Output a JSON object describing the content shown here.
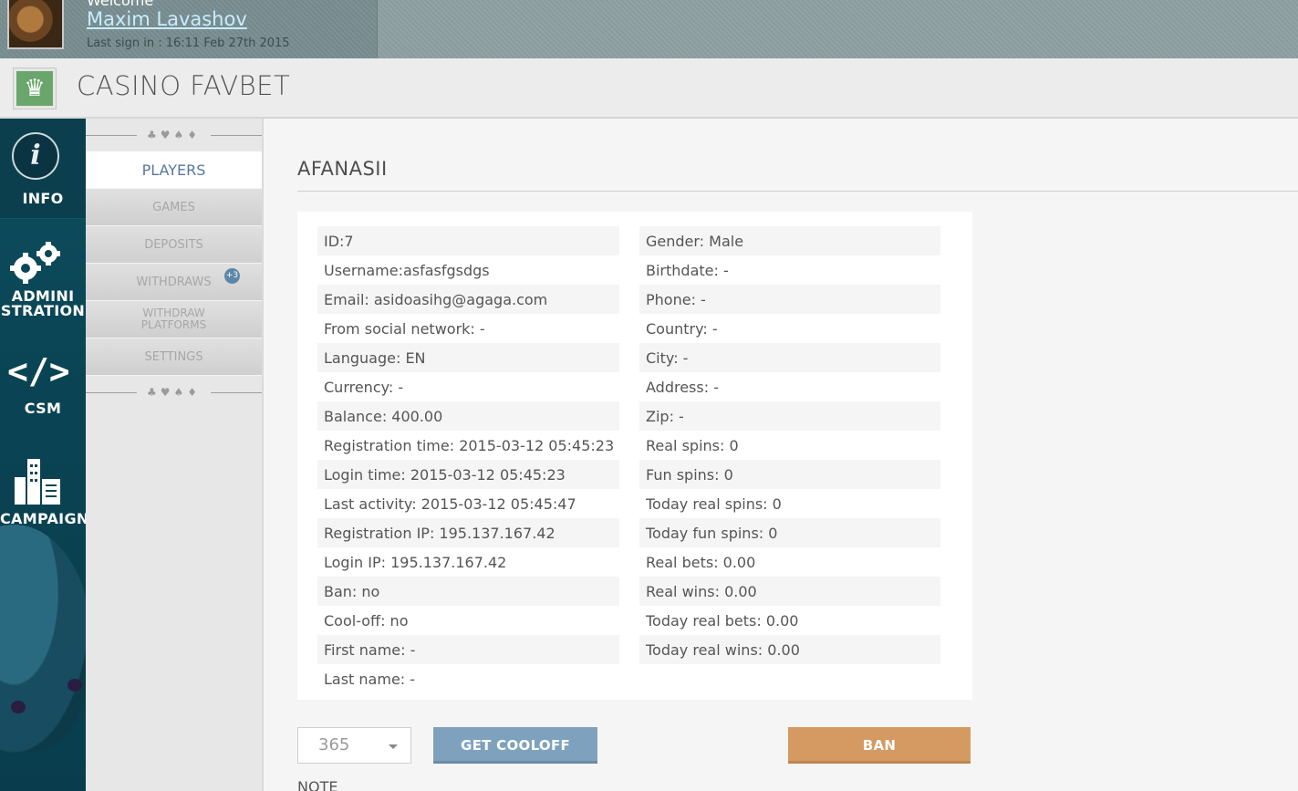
{
  "header": {
    "welcome": "Welcome",
    "user_name": "Maxim Lavashov",
    "last_sign_in": "Last sign in : 16:11 Feb 27th 2015"
  },
  "brand": {
    "title": "CASINO FAVBET",
    "logo_icon": "crown-icon",
    "logo_color": "#6aa66b"
  },
  "left_nav": {
    "items": [
      {
        "label": "INFO",
        "icon": "info-icon"
      },
      {
        "label_line1": "ADMINI",
        "label_line2": "STRATION",
        "icon": "gears-icon"
      },
      {
        "label": "CSM",
        "icon": "code-icon"
      },
      {
        "label": "CAMPAIGNS",
        "icon": "buildings-icon"
      }
    ]
  },
  "sub_nav": {
    "suits": "♣♥♠♦",
    "items": [
      {
        "label": "PLAYERS",
        "active": true
      },
      {
        "label": "GAMES"
      },
      {
        "label": "DEPOSITS"
      },
      {
        "label": "WITHDRAWS",
        "badge": "+3"
      },
      {
        "label_line1": "WITHDRAW",
        "label_line2": "PLATFORMS"
      },
      {
        "label": "SETTINGS"
      }
    ]
  },
  "player": {
    "title": "AFANASII",
    "left_fields": [
      "ID:7",
      "Username:asfasfgsdgs",
      "Email: asidoasihg@agaga.com",
      "From social network: -",
      "Language: EN",
      "Currency: -",
      "Balance: 400.00",
      "Registration time: 2015-03-12 05:45:23",
      "Login time: 2015-03-12 05:45:23",
      "Last activity: 2015-03-12 05:45:47",
      "Registration IP: 195.137.167.42",
      "Login IP: 195.137.167.42",
      "Ban: no",
      "Cool-off: no",
      "First name: -",
      "Last name: -"
    ],
    "right_fields": [
      "Gender: Male",
      "Birthdate: -",
      "Phone: -",
      "Country: -",
      "City: -",
      "Address: -",
      "Zip: -",
      "Real spins: 0",
      "Fun spins: 0",
      "Today real spins: 0",
      "Today fun spins: 0",
      "Real bets: 0.00",
      "Real wins: 0.00",
      "Today real bets: 0.00",
      "Today real wins: 0.00"
    ]
  },
  "actions": {
    "cooloff_days": "365",
    "get_cooloff": "GET COOLOFF",
    "ban": "BAN",
    "note_label": "NOTE",
    "cooloff_color": "#7ea2bd",
    "ban_color": "#d49a62"
  }
}
